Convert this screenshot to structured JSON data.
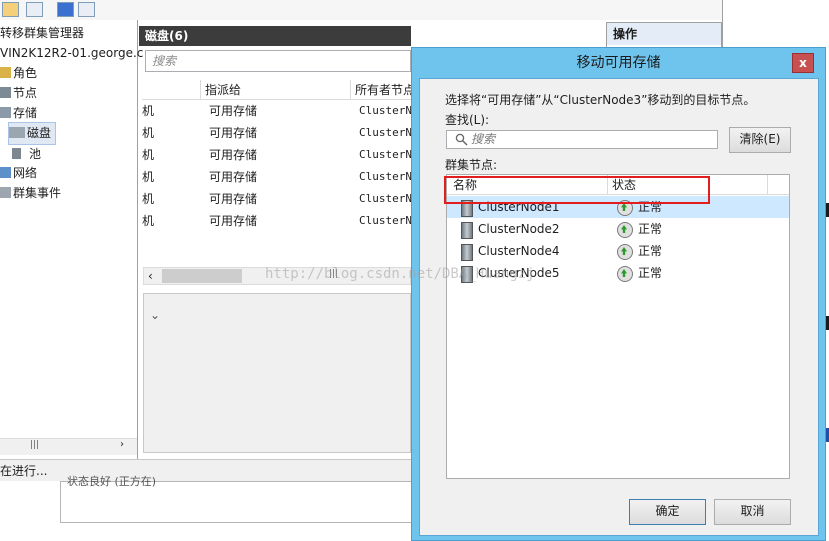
{
  "background": {
    "tree": {
      "header": "转移群集管理器",
      "server": "VIN2K12R2-01.george.c",
      "items": [
        "角色",
        "节点",
        "存储",
        "磁盘",
        "池",
        "网络",
        "群集事件"
      ]
    },
    "disk_panel": {
      "title": "磁盘(6)",
      "search_placeholder": "搜索",
      "columns": [
        "指派给",
        "所有者节点"
      ],
      "rows": [
        {
          "lead": "机",
          "assigned": "可用存储",
          "owner": "ClusterNc"
        },
        {
          "lead": "机",
          "assigned": "可用存储",
          "owner": "ClusterNc"
        },
        {
          "lead": "机",
          "assigned": "可用存储",
          "owner": "ClusterNc"
        },
        {
          "lead": "机",
          "assigned": "可用存储",
          "owner": "ClusterNc"
        },
        {
          "lead": "机",
          "assigned": "可用存储",
          "owner": "ClusterNc"
        },
        {
          "lead": "机",
          "assigned": "可用存储",
          "owner": "ClusterNc"
        }
      ]
    },
    "actions": {
      "title": "操作"
    },
    "status": "在进行...",
    "lower_text": "状态良好 (正方在)"
  },
  "dialog": {
    "title": "移动可用存储",
    "close_glyph": "x",
    "instruction": "选择将“可用存储”从“ClusterNode3”移动到的目标节点。",
    "find_label": "查找(L):",
    "search_placeholder": "搜索",
    "clear_button": "清除(E)",
    "nodes_label": "群集节点:",
    "columns": {
      "name": "名称",
      "status": "状态"
    },
    "nodes": [
      {
        "name": "ClusterNode1",
        "status": "正常"
      },
      {
        "name": "ClusterNode2",
        "status": "正常"
      },
      {
        "name": "ClusterNode4",
        "status": "正常"
      },
      {
        "name": "ClusterNode5",
        "status": "正常"
      }
    ],
    "ok_button": "确定",
    "cancel_button": "取消"
  },
  "watermark": "http://blog.csdn.net/DBA_Huangzj",
  "colors": {
    "title_bar": "#6fc4ed",
    "selection": "#cde8ff",
    "highlight_box": "#e31d1d",
    "close": "#c75050"
  }
}
